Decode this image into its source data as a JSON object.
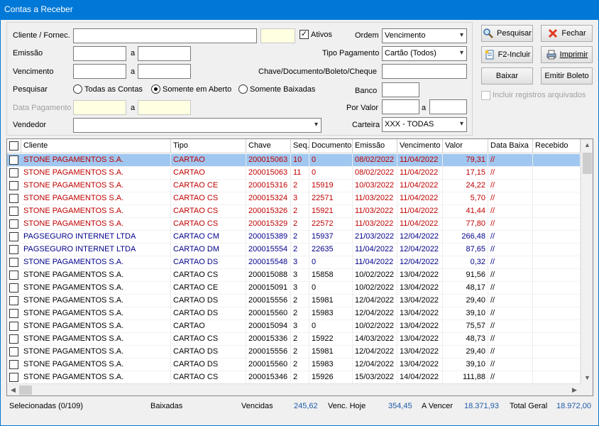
{
  "window": {
    "title": "Contas a Receber"
  },
  "filters": {
    "cliente_label": "Cliente / Fornec.",
    "ativos_label": "Ativos",
    "ordem_label": "Ordem",
    "ordem_value": "Vencimento",
    "emissao_label": "Emissão",
    "a_label": "a",
    "tipo_pagamento_label": "Tipo Pagamento",
    "tipo_pagamento_value": "Cartão (Todos)",
    "vencimento_label": "Vencimento",
    "chave_label": "Chave/Documento/Boleto/Cheque",
    "pesquisar_label": "Pesquisar",
    "radio_todas": "Todas as Contas",
    "radio_aberto": "Somente em Aberto",
    "radio_baixadas": "Somente Baixadas",
    "banco_label": "Banco",
    "data_pagamento_label": "Data Pagamento",
    "por_valor_label": "Por Valor",
    "vendedor_label": "Vendedor",
    "carteira_label": "Carteira",
    "carteira_value": "XXX - TODAS"
  },
  "buttons": {
    "pesquisar": "Pesquisar",
    "fechar": "Fechar",
    "incluir": "F2-Incluir",
    "imprimir": "Imprimir",
    "baixar": "Baixar",
    "emitir_boleto": "Emitir Boleto",
    "incluir_arquivados": "Incluir registros arquivados"
  },
  "grid": {
    "columns": [
      "Cliente",
      "Tipo",
      "Chave",
      "Seq.",
      "Documento",
      "Emissão",
      "Vencimento",
      "Valor",
      "Data Baixa",
      "Recebido"
    ],
    "rows": [
      {
        "cliente": "STONE PAGAMENTOS S.A.",
        "tipo": "CARTAO",
        "chave": "200015063",
        "seq": "10",
        "documento": "0",
        "emissao": "08/02/2022",
        "vencimento": "11/04/2022",
        "valor": "79,31",
        "data_baixa": "//",
        "recebido": "",
        "color": "red",
        "selected": true
      },
      {
        "cliente": "STONE PAGAMENTOS S.A.",
        "tipo": "CARTAO",
        "chave": "200015063",
        "seq": "11",
        "documento": "0",
        "emissao": "08/02/2022",
        "vencimento": "11/04/2022",
        "valor": "17,15",
        "data_baixa": "//",
        "recebido": "",
        "color": "red",
        "selected": false
      },
      {
        "cliente": "STONE PAGAMENTOS S.A.",
        "tipo": "CARTAO CE",
        "chave": "200015316",
        "seq": "2",
        "documento": "15919",
        "emissao": "10/03/2022",
        "vencimento": "11/04/2022",
        "valor": "24,22",
        "data_baixa": "//",
        "recebido": "",
        "color": "red",
        "selected": false
      },
      {
        "cliente": "STONE PAGAMENTOS S.A.",
        "tipo": "CARTAO CS",
        "chave": "200015324",
        "seq": "3",
        "documento": "22571",
        "emissao": "11/03/2022",
        "vencimento": "11/04/2022",
        "valor": "5,70",
        "data_baixa": "//",
        "recebido": "",
        "color": "red",
        "selected": false
      },
      {
        "cliente": "STONE PAGAMENTOS S.A.",
        "tipo": "CARTAO CS",
        "chave": "200015326",
        "seq": "2",
        "documento": "15921",
        "emissao": "11/03/2022",
        "vencimento": "11/04/2022",
        "valor": "41,44",
        "data_baixa": "//",
        "recebido": "",
        "color": "red",
        "selected": false
      },
      {
        "cliente": "STONE PAGAMENTOS S.A.",
        "tipo": "CARTAO CS",
        "chave": "200015329",
        "seq": "2",
        "documento": "22572",
        "emissao": "11/03/2022",
        "vencimento": "11/04/2022",
        "valor": "77,80",
        "data_baixa": "//",
        "recebido": "",
        "color": "red",
        "selected": false
      },
      {
        "cliente": "PAGSEGURO INTERNET LTDA",
        "tipo": "CARTAO CM",
        "chave": "200015389",
        "seq": "2",
        "documento": "15937",
        "emissao": "21/03/2022",
        "vencimento": "12/04/2022",
        "valor": "266,48",
        "data_baixa": "//",
        "recebido": "",
        "color": "blue",
        "selected": false
      },
      {
        "cliente": "PAGSEGURO INTERNET LTDA",
        "tipo": "CARTAO DM",
        "chave": "200015554",
        "seq": "2",
        "documento": "22635",
        "emissao": "11/04/2022",
        "vencimento": "12/04/2022",
        "valor": "87,65",
        "data_baixa": "//",
        "recebido": "",
        "color": "blue",
        "selected": false
      },
      {
        "cliente": "STONE PAGAMENTOS S.A.",
        "tipo": "CARTAO DS",
        "chave": "200015548",
        "seq": "3",
        "documento": "0",
        "emissao": "11/04/2022",
        "vencimento": "12/04/2022",
        "valor": "0,32",
        "data_baixa": "//",
        "recebido": "",
        "color": "blue",
        "selected": false
      },
      {
        "cliente": "STONE PAGAMENTOS S.A.",
        "tipo": "CARTAO CS",
        "chave": "200015088",
        "seq": "3",
        "documento": "15858",
        "emissao": "10/02/2022",
        "vencimento": "13/04/2022",
        "valor": "91,56",
        "data_baixa": "//",
        "recebido": "",
        "color": "black",
        "selected": false
      },
      {
        "cliente": "STONE PAGAMENTOS S.A.",
        "tipo": "CARTAO CE",
        "chave": "200015091",
        "seq": "3",
        "documento": "0",
        "emissao": "10/02/2022",
        "vencimento": "13/04/2022",
        "valor": "48,17",
        "data_baixa": "//",
        "recebido": "",
        "color": "black",
        "selected": false
      },
      {
        "cliente": "STONE PAGAMENTOS S.A.",
        "tipo": "CARTAO DS",
        "chave": "200015556",
        "seq": "2",
        "documento": "15981",
        "emissao": "12/04/2022",
        "vencimento": "13/04/2022",
        "valor": "29,40",
        "data_baixa": "//",
        "recebido": "",
        "color": "black",
        "selected": false
      },
      {
        "cliente": "STONE PAGAMENTOS S.A.",
        "tipo": "CARTAO DS",
        "chave": "200015560",
        "seq": "2",
        "documento": "15983",
        "emissao": "12/04/2022",
        "vencimento": "13/04/2022",
        "valor": "39,10",
        "data_baixa": "//",
        "recebido": "",
        "color": "black",
        "selected": false
      },
      {
        "cliente": "STONE PAGAMENTOS S.A.",
        "tipo": "CARTAO",
        "chave": "200015094",
        "seq": "3",
        "documento": "0",
        "emissao": "10/02/2022",
        "vencimento": "13/04/2022",
        "valor": "75,57",
        "data_baixa": "//",
        "recebido": "",
        "color": "black",
        "selected": false
      },
      {
        "cliente": "STONE PAGAMENTOS S.A.",
        "tipo": "CARTAO CS",
        "chave": "200015336",
        "seq": "2",
        "documento": "15922",
        "emissao": "14/03/2022",
        "vencimento": "13/04/2022",
        "valor": "48,73",
        "data_baixa": "//",
        "recebido": "",
        "color": "black",
        "selected": false
      },
      {
        "cliente": "STONE PAGAMENTOS S.A.",
        "tipo": "CARTAO DS",
        "chave": "200015556",
        "seq": "2",
        "documento": "15981",
        "emissao": "12/04/2022",
        "vencimento": "13/04/2022",
        "valor": "29,40",
        "data_baixa": "//",
        "recebido": "",
        "color": "black",
        "selected": false
      },
      {
        "cliente": "STONE PAGAMENTOS S.A.",
        "tipo": "CARTAO DS",
        "chave": "200015560",
        "seq": "2",
        "documento": "15983",
        "emissao": "12/04/2022",
        "vencimento": "13/04/2022",
        "valor": "39,10",
        "data_baixa": "//",
        "recebido": "",
        "color": "black",
        "selected": false
      },
      {
        "cliente": "STONE PAGAMENTOS S.A.",
        "tipo": "CARTAO CS",
        "chave": "200015346",
        "seq": "2",
        "documento": "15926",
        "emissao": "15/03/2022",
        "vencimento": "14/04/2022",
        "valor": "111,88",
        "data_baixa": "//",
        "recebido": "",
        "color": "black",
        "selected": false
      }
    ]
  },
  "status": {
    "selecionadas": "Selecionadas (0/109)",
    "baixadas": "Baixadas",
    "vencidas_label": "Vencidas",
    "vencidas_value": "245,62",
    "venc_hoje_label": "Venc. Hoje",
    "venc_hoje_value": "354,45",
    "a_vencer_label": "A Vencer",
    "a_vencer_value": "18.371,93",
    "total_geral_label": "Total Geral",
    "total_geral_value": "18.972,00"
  },
  "colors": {
    "title_bar": "#0078d7",
    "selected_row": "#9fc7f0",
    "red_text": "#c00000",
    "blue_text": "#00008b",
    "status_values": "#1e5aa8"
  }
}
